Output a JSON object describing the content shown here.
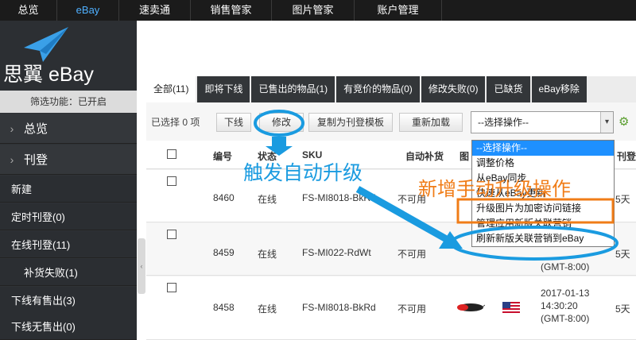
{
  "topnav": [
    "总览",
    "eBay",
    "速卖通",
    "销售管家",
    "图片管家",
    "账户管理"
  ],
  "logo": {
    "text": "思翼 eBay"
  },
  "sidebar": {
    "filter": "筛选功能：已开启",
    "major": [
      "总览",
      "刊登"
    ],
    "items": [
      "新建",
      "定时刊登(0)",
      "在线刊登(11)",
      "补货失败(1)",
      "下线有售出(3)",
      "下线无售出(0)"
    ]
  },
  "tabs": [
    "全部(11)",
    "即将下线",
    "已售出的物品(1)",
    "有竞价的物品(0)",
    "修改失败(0)",
    "已缺货",
    "eBay移除"
  ],
  "toolbar": {
    "selected": "已选择 0 项",
    "buttons": [
      "下线",
      "修改",
      "复制为刊登模板",
      "重新加载"
    ],
    "select_value": "--选择操作--"
  },
  "columns": [
    "编号",
    "状态",
    "SKU",
    "自动补货",
    "图",
    "刊登"
  ],
  "rows": [
    {
      "id": "8460",
      "status": "在线",
      "sku": "FS-MI8018-BkRd",
      "restock": "不可用",
      "date": "",
      "time": "",
      "tz": "",
      "days": "5天"
    },
    {
      "id": "8459",
      "status": "在线",
      "sku": "FS-MI022-RdWt",
      "restock": "不可用",
      "date": "",
      "time": "",
      "tz": "(GMT-8:00)",
      "days": "5天"
    },
    {
      "id": "8458",
      "status": "在线",
      "sku": "FS-MI8018-BkRd",
      "restock": "不可用",
      "date": "2017-01-13",
      "time": "14:30:20",
      "tz": "(GMT-8:00)",
      "days": "5天"
    }
  ],
  "dropdown": [
    "--选择操作--",
    "调整价格",
    "从eBay同步",
    "快速从eBay更新",
    "升级图片为加密访问链接",
    "管理应用新版关联营销",
    "刷新新版关联营销到eBay"
  ],
  "annotations": {
    "trigger": "触发自动升级",
    "new_op": "新增手动升级操作"
  },
  "colors": {
    "accent": "#1a9be0",
    "orange": "#f07c17",
    "dark": "#2f3236"
  }
}
